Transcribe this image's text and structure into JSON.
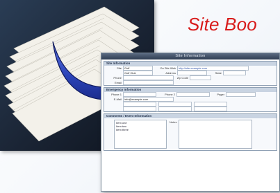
{
  "title": "Site Boo",
  "form": {
    "window_title": "Site Information",
    "sections": {
      "site_info": "Site Information",
      "emergency": "Emergency Information",
      "comments": "Comments / Event Information"
    },
    "site": {
      "site_label": "Site",
      "site_value": "Golf",
      "url_label": "On Site Web",
      "url_value": "http://site.example.com",
      "name_value": "Golf Club",
      "address_label": "Address",
      "phone_label": "Phone",
      "email_label": "Email",
      "state_label": "State",
      "zip_label": "Zip Code"
    },
    "emergency": {
      "phone1_label": "Phone 1",
      "phone2_label": "Phone 2",
      "pager_label": "Pager",
      "email_label": "E-Mail",
      "email_value": "info@example.com"
    },
    "comments": {
      "items": [
        "Item one",
        "Item two",
        "Item three"
      ],
      "notes_label": "Notes"
    }
  },
  "colors": {
    "title": "#d81b1b",
    "arrow": "#2a43b8",
    "frame": "#2f3d52"
  }
}
